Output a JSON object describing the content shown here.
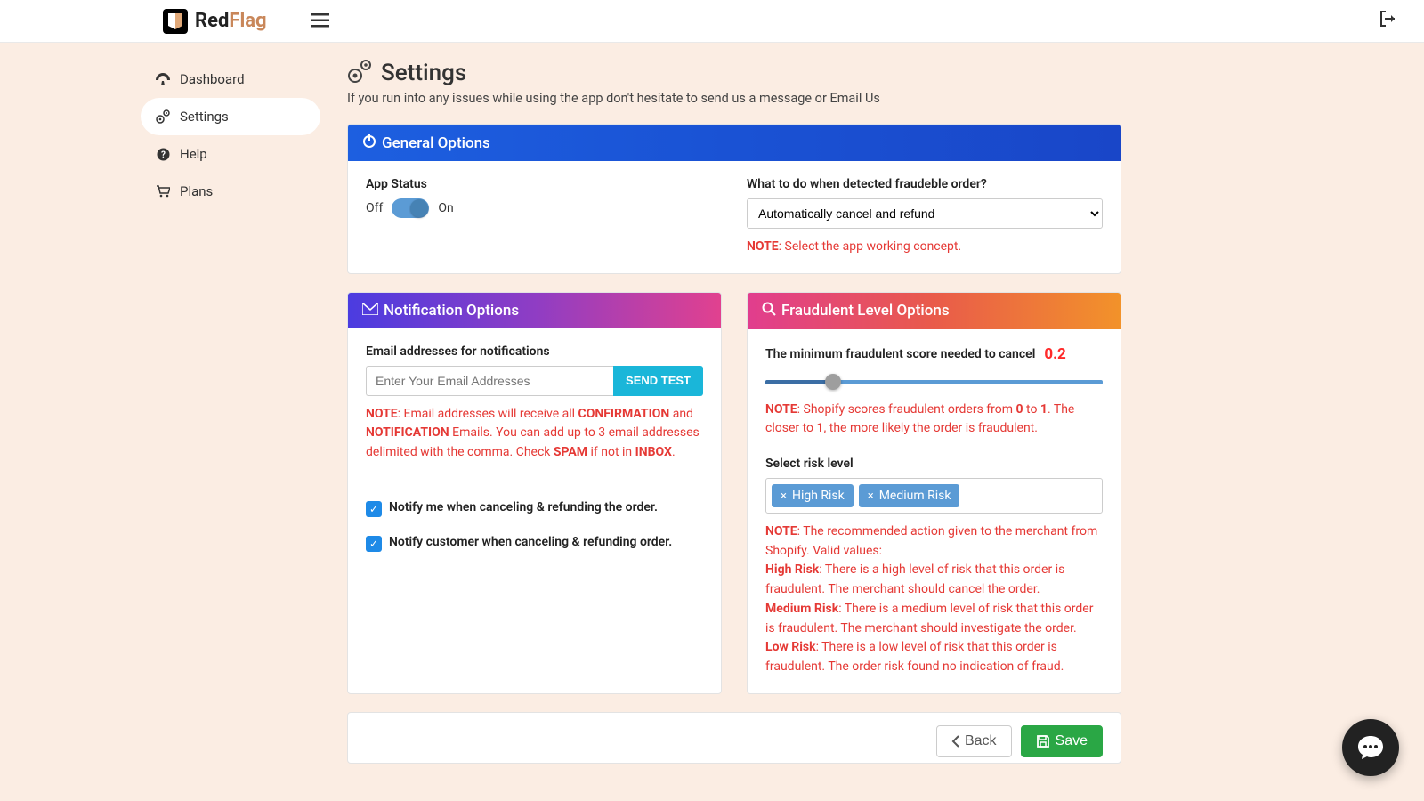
{
  "brand": {
    "red": "Red",
    "flag": "Flag"
  },
  "sidebar": {
    "items": [
      {
        "label": "Dashboard"
      },
      {
        "label": "Settings"
      },
      {
        "label": "Help"
      },
      {
        "label": "Plans"
      }
    ]
  },
  "page": {
    "title": "Settings",
    "subtitle": "If you run into any issues while using the app don't hesitate to send us a message or Email Us"
  },
  "general": {
    "header": "General Options",
    "app_status_label": "App Status",
    "off": "Off",
    "on": "On",
    "fraud_action_label": "What to do when detected fraudeble order?",
    "fraud_action_selected": "Automatically cancel and refund",
    "note_prefix": "NOTE",
    "note_text": ": Select the app working concept."
  },
  "notification": {
    "header": "Notification Options",
    "email_label": "Email addresses for notifications",
    "placeholder": "Enter Your Email Addresses",
    "send_test": "SEND TEST",
    "note_prefix": "NOTE",
    "note_1a": ": Email addresses will receive all ",
    "note_conf": "CONFIRMATION",
    "note_and": " and ",
    "note_notif": "NOTIFICATION",
    "note_1b": " Emails. You can add up to 3 email addresses delimited with the comma. Check ",
    "note_spam": "SPAM",
    "note_1c": " if not in ",
    "note_inbox": "INBOX",
    "note_1d": ".",
    "check1": "Notify me when canceling & refunding the order.",
    "check2": "Notify customer when canceling & refunding order."
  },
  "fraud": {
    "header": "Fraudulent Level Options",
    "score_label": "The minimum fraudulent score needed to cancel",
    "score_value": "0.2",
    "note_prefix": "NOTE",
    "note_scores_a": ": Shopify scores fraudulent orders from ",
    "zero": "0",
    "to": " to ",
    "one": "1",
    "note_scores_b": ". The closer to ",
    "note_scores_c": ", the more likely the order is fraudulent.",
    "risk_label": "Select risk level",
    "chip_high": "High Risk",
    "chip_med": "Medium Risk",
    "note_rec_a": ": The recommended action given to the merchant from Shopify. Valid values:",
    "high_b": "High Risk",
    "high_t": ": There is a high level of risk that this order is fraudulent. The merchant should cancel the order.",
    "med_b": "Medium Risk",
    "med_t": ": There is a medium level of risk that this order is fraudulent. The merchant should investigate the order.",
    "low_b": "Low Risk",
    "low_t": ": There is a low level of risk that this order is fraudulent. The order risk found no indication of fraud."
  },
  "buttons": {
    "back": "Back",
    "save": "Save"
  }
}
